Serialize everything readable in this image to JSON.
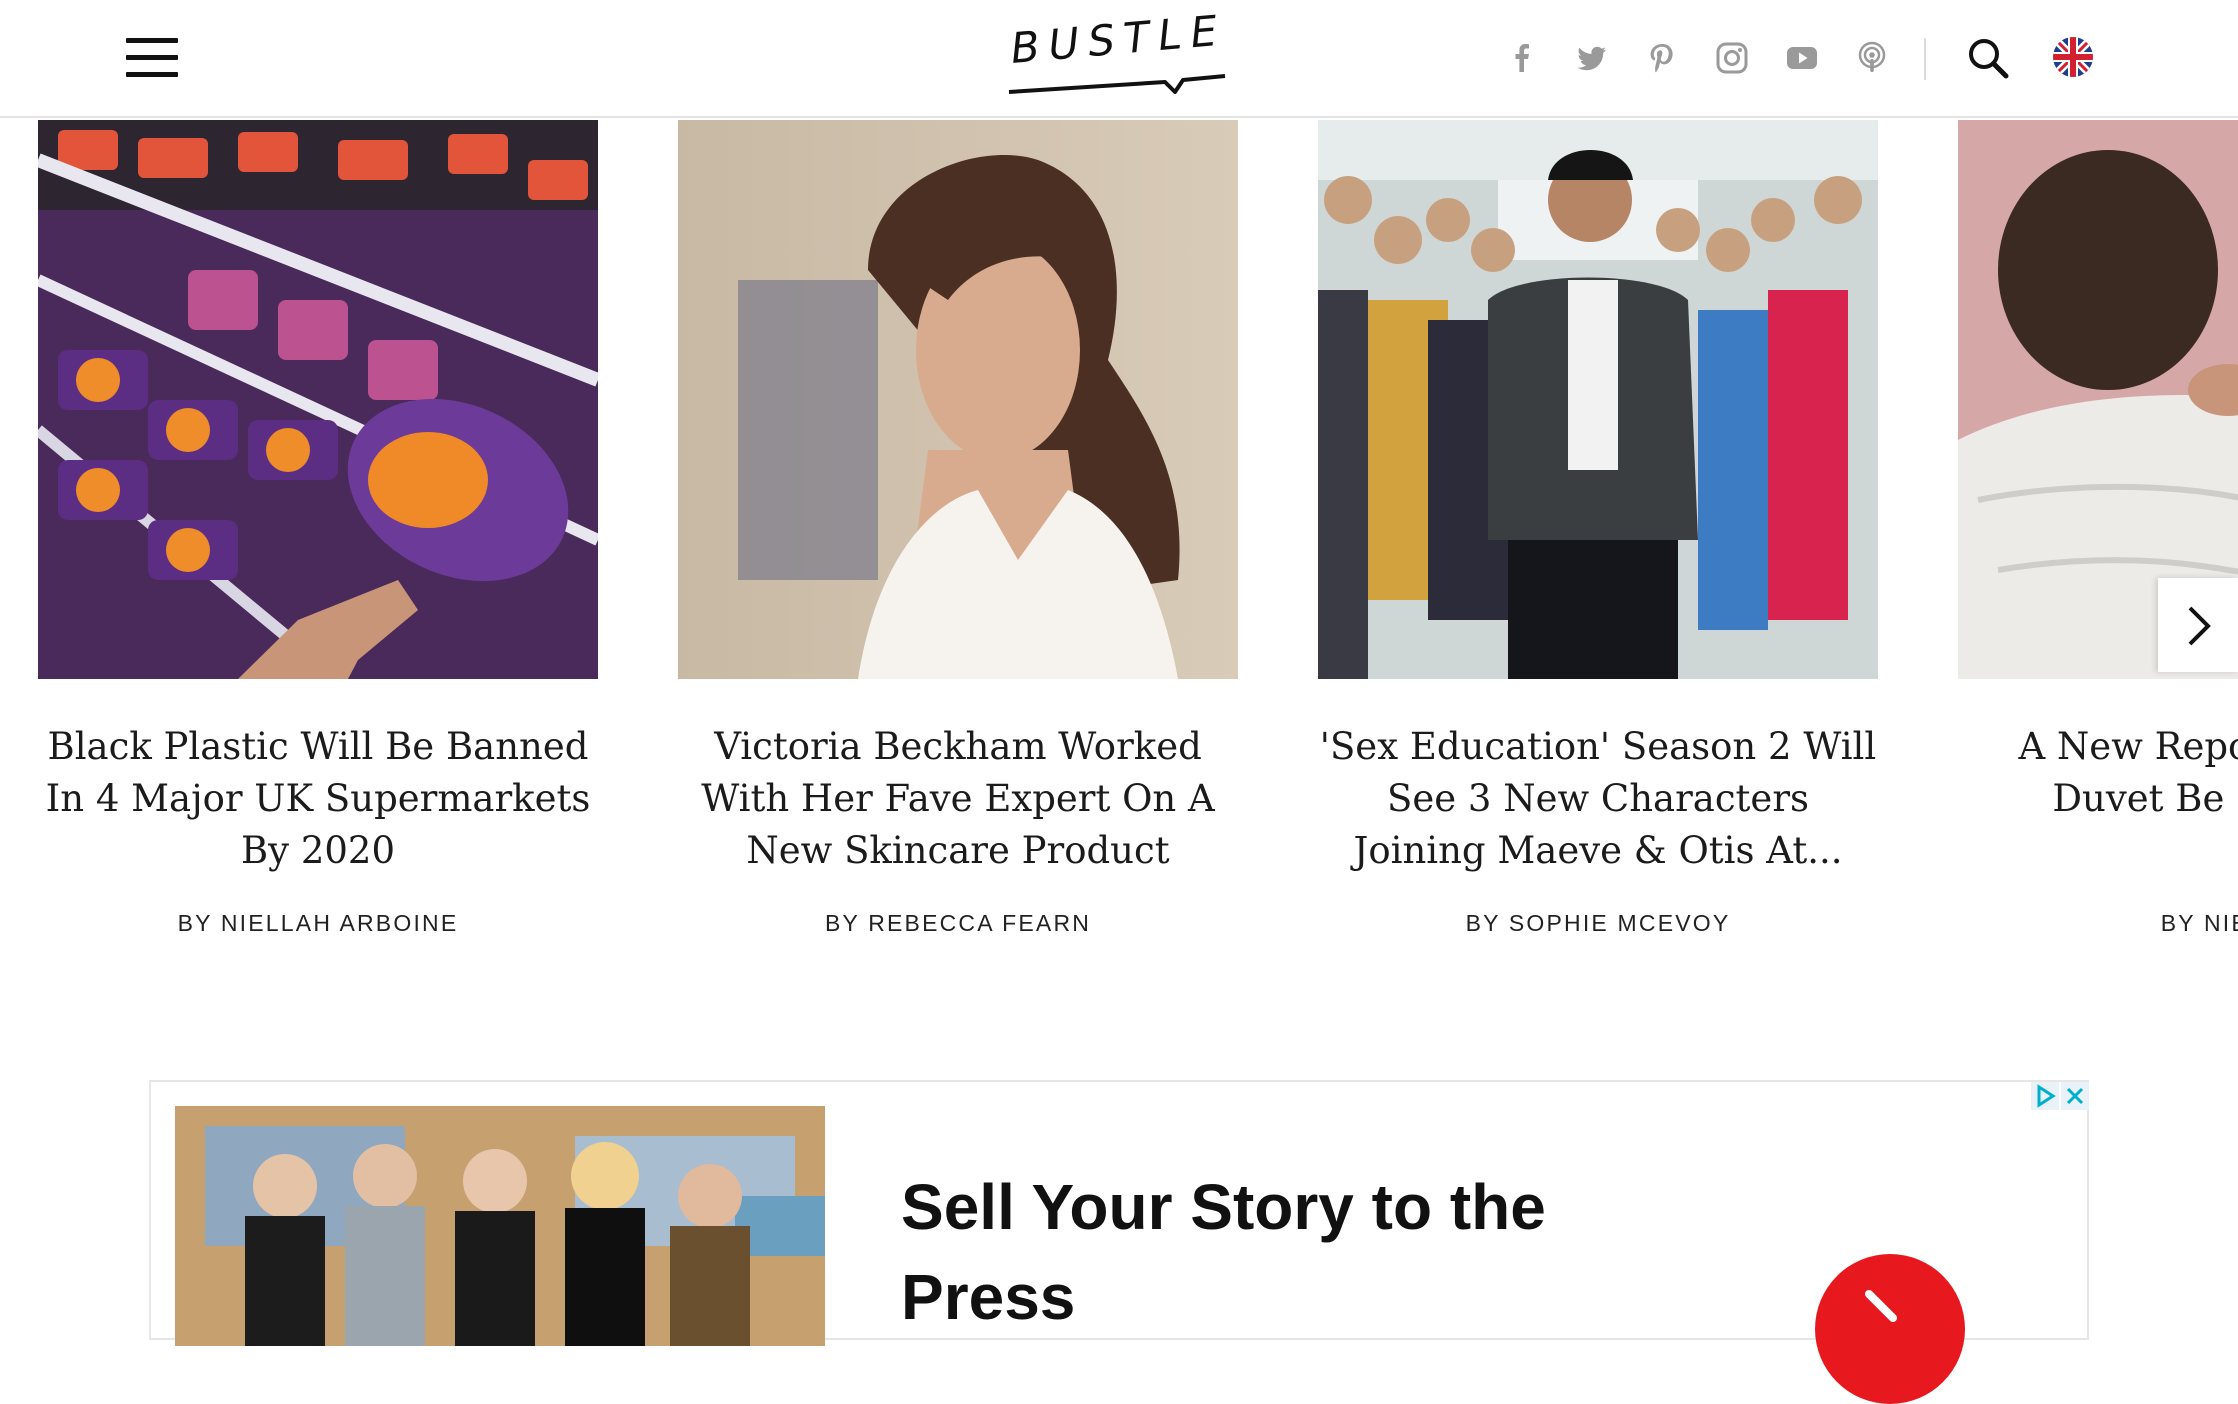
{
  "header": {
    "logo": "BUSTLE",
    "icons": [
      "hamburger-menu-icon",
      "facebook-icon",
      "twitter-icon",
      "pinterest-icon",
      "instagram-icon",
      "youtube-icon",
      "podcast-icon",
      "search-icon",
      "uk-flag-icon"
    ]
  },
  "colors": {
    "text": "#1b1b1b",
    "icon_gray": "#9a9a9a",
    "ad_cta": "#e8191e",
    "adchoices": "#00aecd"
  },
  "articles": [
    {
      "title": "Black Plastic Will Be Banned In 4 Major UK Supermarkets By 2020",
      "byline": "BY NIELLAH ARBOINE",
      "image": "supermarket-shelf-photo"
    },
    {
      "title": "Victoria Beckham Worked With Her Fave Expert On A New Skincare Product",
      "byline": "BY REBECCA FEARN",
      "image": "victoria-beckham-photo"
    },
    {
      "title": "'Sex Education' Season 2 Will See 3 New Characters Joining Maeve & Otis At...",
      "byline": "BY SOPHIE MCEVOY",
      "image": "sex-education-cast-photo"
    },
    {
      "title": "A New Report \"Feather Duvet Be Behind Yo",
      "byline": "BY NIELLAH",
      "image": "person-in-bed-photo"
    }
  ],
  "ad": {
    "headline": "Sell Your Story to the Press",
    "image": "tv-studio-group-photo"
  }
}
